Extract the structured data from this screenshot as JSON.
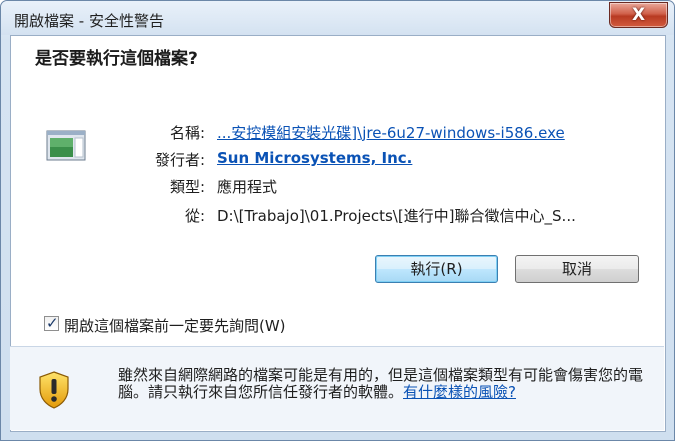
{
  "window": {
    "title": "開啟檔案 - 安全性警告",
    "close_symbol": "X"
  },
  "dialog": {
    "heading": "是否要執行這個檔案?",
    "fields": [
      {
        "label": "名稱:",
        "value": "...安控模組安裝光碟]\\jre-6u27-windows-i586.exe"
      },
      {
        "label": "發行者:",
        "value": "Sun Microsystems, Inc."
      },
      {
        "label": "類型:",
        "value": "應用程式"
      },
      {
        "label": "從:",
        "value": "D:\\[Trabajo]\\01.Projects\\[進行中]聯合徵信中心_S..."
      }
    ],
    "icon": "application-icon"
  },
  "buttons": {
    "run": "執行(R)",
    "cancel": "取消"
  },
  "checkbox": {
    "label": "開啟這個檔案前一定要先詢問(W)",
    "checked": true
  },
  "warning": {
    "icon": "shield-warning-icon",
    "text": "雖然來自網際網路的檔案可能是有用的，但是這個檔案類型有可能會傷害您的電腦。請只執行來自您所信任發行者的軟體。",
    "link": "有什麼樣的風險?"
  },
  "colors": {
    "link": "#0a52b5",
    "close_red": "#c7462c",
    "frame": "#d8e6f4"
  }
}
